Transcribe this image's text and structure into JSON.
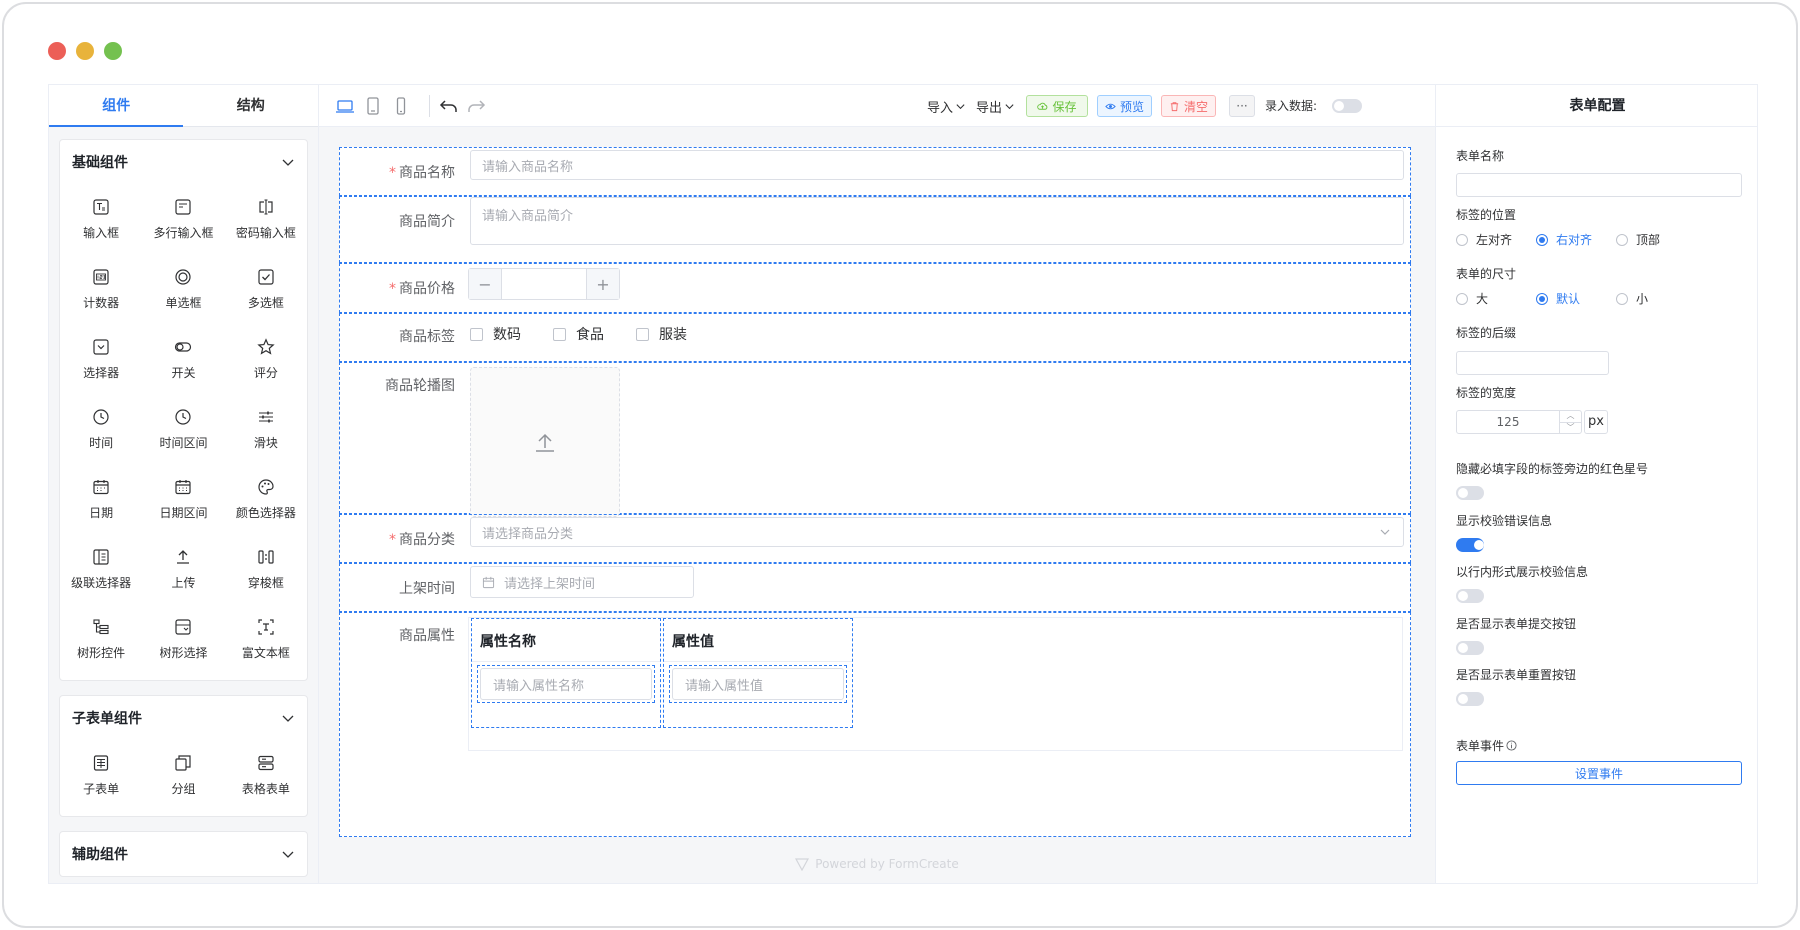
{
  "colors": {
    "accent": "#2f7bf0",
    "save": "#67c23a",
    "preview": "#2f7bf0",
    "clear": "#f56c6c",
    "required": "#f56c6c"
  },
  "left_panel": {
    "tabs": [
      {
        "label": "组件"
      },
      {
        "label": "结构"
      }
    ],
    "groups": [
      {
        "title": "基础组件",
        "items": [
          {
            "label": "输入框",
            "icon": "input-icon"
          },
          {
            "label": "多行输入框",
            "icon": "textarea-icon"
          },
          {
            "label": "密码输入框",
            "icon": "password-icon"
          },
          {
            "label": "计数器",
            "icon": "counter-icon"
          },
          {
            "label": "单选框",
            "icon": "radio-icon"
          },
          {
            "label": "多选框",
            "icon": "checkbox-icon"
          },
          {
            "label": "选择器",
            "icon": "select-icon"
          },
          {
            "label": "开关",
            "icon": "switch-icon"
          },
          {
            "label": "评分",
            "icon": "star-icon"
          },
          {
            "label": "时间",
            "icon": "clock-icon"
          },
          {
            "label": "时间区间",
            "icon": "clock-range-icon"
          },
          {
            "label": "滑块",
            "icon": "slider-icon"
          },
          {
            "label": "日期",
            "icon": "calendar-icon"
          },
          {
            "label": "日期区间",
            "icon": "calendar-range-icon"
          },
          {
            "label": "颜色选择器",
            "icon": "palette-icon"
          },
          {
            "label": "级联选择器",
            "icon": "cascader-icon"
          },
          {
            "label": "上传",
            "icon": "upload-icon"
          },
          {
            "label": "穿梭框",
            "icon": "transfer-icon"
          },
          {
            "label": "树形控件",
            "icon": "tree-icon"
          },
          {
            "label": "树形选择",
            "icon": "tree-select-icon"
          },
          {
            "label": "富文本框",
            "icon": "richtext-icon"
          }
        ]
      },
      {
        "title": "子表单组件",
        "items": [
          {
            "label": "子表单",
            "icon": "subform-icon"
          },
          {
            "label": "分组",
            "icon": "group-icon"
          },
          {
            "label": "表格表单",
            "icon": "table-form-icon"
          }
        ]
      },
      {
        "title": "辅助组件",
        "items": []
      }
    ]
  },
  "toolbar": {
    "import_label": "导入",
    "export_label": "导出",
    "save_label": "保存",
    "preview_label": "预览",
    "clear_label": "清空",
    "more_label": "···",
    "record_label": "录入数据:"
  },
  "form": {
    "fields": {
      "name": {
        "label": "商品名称",
        "placeholder": "请输入商品名称",
        "required": true
      },
      "intro": {
        "label": "商品简介",
        "placeholder": "请输入商品简介"
      },
      "price": {
        "label": "商品价格",
        "required": true,
        "minus": "−",
        "plus": "+"
      },
      "tags": {
        "label": "商品标签",
        "options": [
          "数码",
          "食品",
          "服装"
        ]
      },
      "carousel": {
        "label": "商品轮播图"
      },
      "category": {
        "label": "商品分类",
        "placeholder": "请选择商品分类",
        "required": true
      },
      "shelf_time": {
        "label": "上架时间",
        "placeholder": "请选择上架时间"
      },
      "attrs": {
        "label": "商品属性",
        "columns": [
          {
            "header": "属性名称",
            "placeholder": "请输入属性名称"
          },
          {
            "header": "属性值",
            "placeholder": "请输入属性值"
          }
        ]
      }
    },
    "powered_by": "Powered by FormCreate"
  },
  "right_panel": {
    "title": "表单配置",
    "form_name_label": "表单名称",
    "label_position": {
      "label": "标签的位置",
      "options": [
        "左对齐",
        "右对齐",
        "顶部"
      ],
      "selected": 1
    },
    "form_size": {
      "label": "表单的尺寸",
      "options": [
        "大",
        "默认",
        "小"
      ],
      "selected": 1
    },
    "label_suffix_label": "标签的后缀",
    "label_width": {
      "label": "标签的宽度",
      "value": "125",
      "unit": "px"
    },
    "switches": [
      {
        "label": "隐藏必填字段的标签旁边的红色星号",
        "on": false
      },
      {
        "label": "显示校验错误信息",
        "on": true
      },
      {
        "label": "以行内形式展示校验信息",
        "on": false
      },
      {
        "label": "是否显示表单提交按钮",
        "on": false
      },
      {
        "label": "是否显示表单重置按钮",
        "on": false
      }
    ],
    "events_label": "表单事件",
    "events_button": "设置事件"
  }
}
